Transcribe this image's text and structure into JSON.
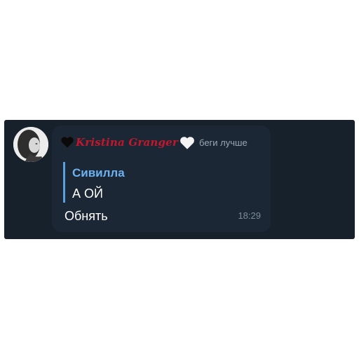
{
  "message": {
    "sender_name": "Kristina Granger",
    "sender_title": "беги лучше",
    "reply_to": {
      "author": "Сивилла",
      "text": "А ОЙ"
    },
    "text": "Обнять",
    "time": "18:29"
  },
  "icons": {
    "left": "black-heart-icon",
    "right": "white-heart-icon"
  },
  "colors": {
    "panel": "#17212b",
    "bubble": "#1b2735",
    "name": "#c2182d",
    "reply_accent": "#5aa0e0"
  }
}
